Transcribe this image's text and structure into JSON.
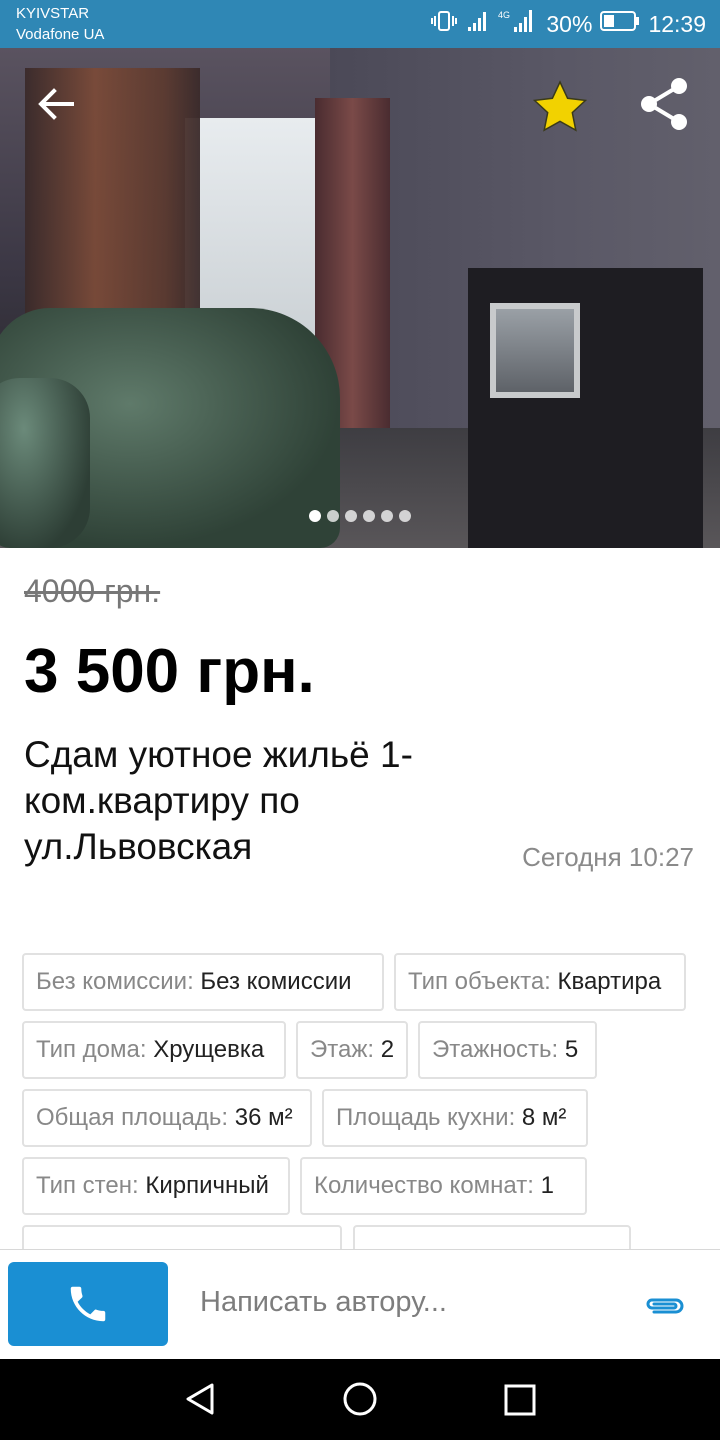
{
  "status_bar": {
    "carrier_1": "KYIVSTAR",
    "carrier_2": "Vodafone UA",
    "network_label": "4G",
    "battery": "30%",
    "time": "12:39"
  },
  "gallery": {
    "photo_count": 6,
    "active_index": 0
  },
  "listing": {
    "old_price": "4000 грн.",
    "price": "3 500 грн.",
    "title": "Сдам уютное жильё 1-ком.квартиру по ул.Львовская",
    "date": "Сегодня 10:27"
  },
  "attributes": [
    {
      "key": "Без комиссии: ",
      "value": "Без комиссии"
    },
    {
      "key": "Тип объекта: ",
      "value": "Квартира"
    },
    {
      "key": "Тип дома: ",
      "value": "Хрущевка"
    },
    {
      "key": "Этаж: ",
      "value": "2"
    },
    {
      "key": "Этажность: ",
      "value": "5"
    },
    {
      "key": "Общая площадь: ",
      "value": "36 м²"
    },
    {
      "key": "Площадь кухни: ",
      "value": "8 м²"
    },
    {
      "key": "Тип стен: ",
      "value": "Кирпичный"
    },
    {
      "key": "Количество комнат: ",
      "value": "1"
    }
  ],
  "action_bar": {
    "message_placeholder": "Написать автору..."
  },
  "colors": {
    "status_bar": "#2f87b5",
    "call_button": "#1a8fd3",
    "favorite_star": "#f2d200",
    "attach_icon": "#1a8fd3"
  },
  "icons": {
    "back": "arrow-left-icon",
    "favorite": "star-icon",
    "share": "share-icon",
    "call": "phone-icon",
    "attach": "paperclip-icon"
  }
}
